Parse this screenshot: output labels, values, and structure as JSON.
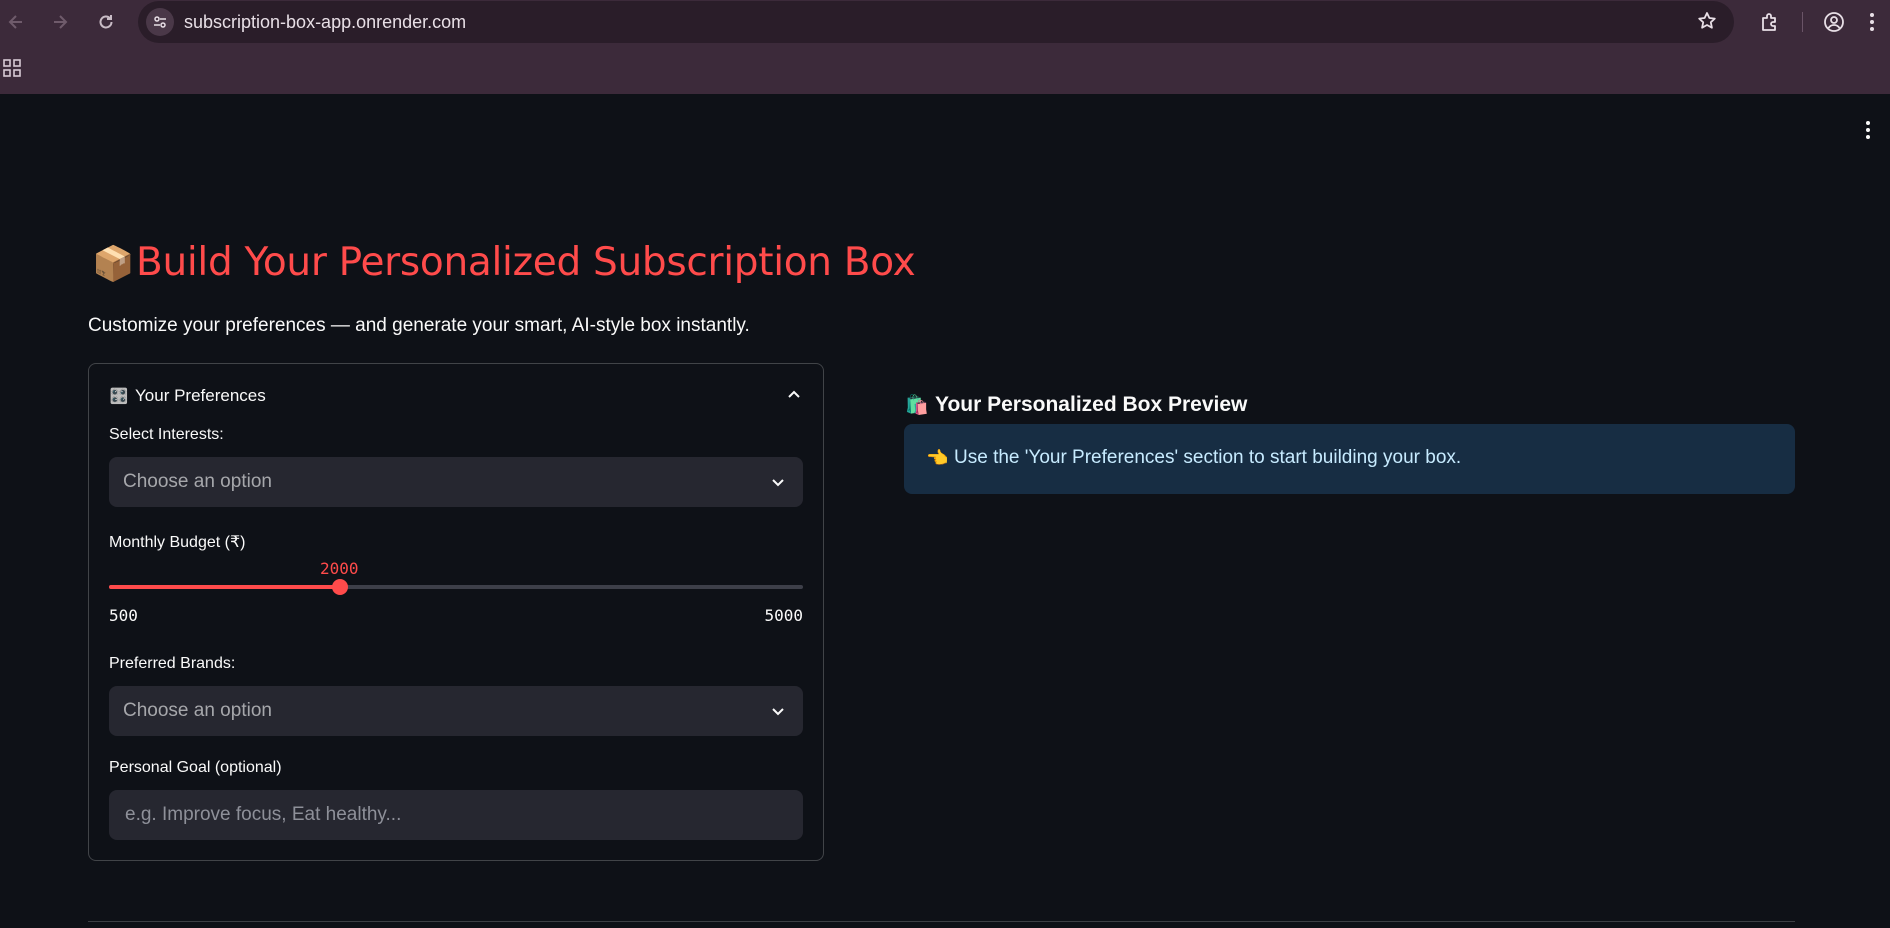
{
  "browser": {
    "url": "subscription-box-app.onrender.com",
    "icons": [
      "back-icon",
      "forward-icon",
      "reload-icon",
      "site-settings-icon",
      "bookmark-star-icon",
      "extensions-icon",
      "profile-icon",
      "apps-grid-icon"
    ]
  },
  "page": {
    "title_emoji": "📦",
    "title": "Build Your Personalized Subscription Box",
    "subtitle": "Customize your preferences — and generate your smart, AI-style box instantly."
  },
  "preferences": {
    "header_emoji": "🎛️",
    "header": "Your Preferences",
    "interests": {
      "label": "Select Interests:",
      "placeholder": "Choose an option"
    },
    "budget": {
      "label": "Monthly Budget (₹)",
      "value": "2000",
      "min": "500",
      "max": "5000",
      "fraction": 0.3333
    },
    "brands": {
      "label": "Preferred Brands:",
      "placeholder": "Choose an option"
    },
    "goal": {
      "label": "Personal Goal (optional)",
      "placeholder": "e.g. Improve focus, Eat healthy..."
    }
  },
  "preview": {
    "header_emoji": "🛍️",
    "header": "Your Personalized Box Preview",
    "info_emoji": "👈",
    "info": "Use the 'Your Preferences' section to start building your box."
  },
  "colors": {
    "accent": "#ff4b4b",
    "background": "#0e1117",
    "input_bg": "#262730",
    "info_bg": "#172d43",
    "info_text": "#c7ebff"
  }
}
